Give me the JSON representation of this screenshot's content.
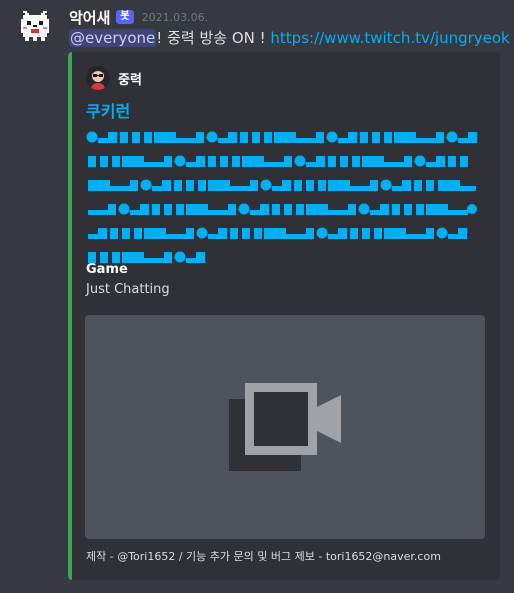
{
  "message": {
    "username": "악어새",
    "bot_tag": "봇",
    "timestamp": "2021.03.06.",
    "mention": "@everyone",
    "text": "! 중력 방송 ON ! ",
    "link": "https://www.twitch.tv/jungryeok"
  },
  "embed": {
    "accent_color": "#3ba55c",
    "author": {
      "name": "중력",
      "icon": "streamer-avatar-icon"
    },
    "title": "쿠키런",
    "field": {
      "name": "Game",
      "value": "Just Chatting"
    },
    "image_icon": "video-camera-icon",
    "footer": "제작 - @Tori1652 / 기능 추가 문의 및 버그 제보 - tori1652@naver.com"
  }
}
